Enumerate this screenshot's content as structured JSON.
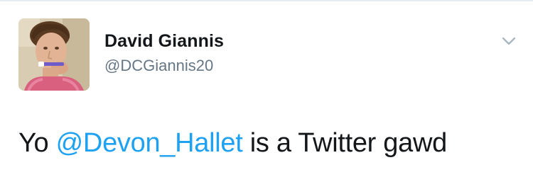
{
  "tweet": {
    "author": {
      "display_name": "David Giannis",
      "handle": "@DCGiannis20"
    },
    "menu_icon": "chevron-down-icon",
    "text": {
      "prefix": "Yo ",
      "mention": "@Devon_Hallet",
      "suffix": " is a Twitter gawd"
    }
  },
  "colors": {
    "mention": "#1da1f2",
    "handle": "#657786",
    "text": "#14171a",
    "chevron": "#aab8c2"
  }
}
